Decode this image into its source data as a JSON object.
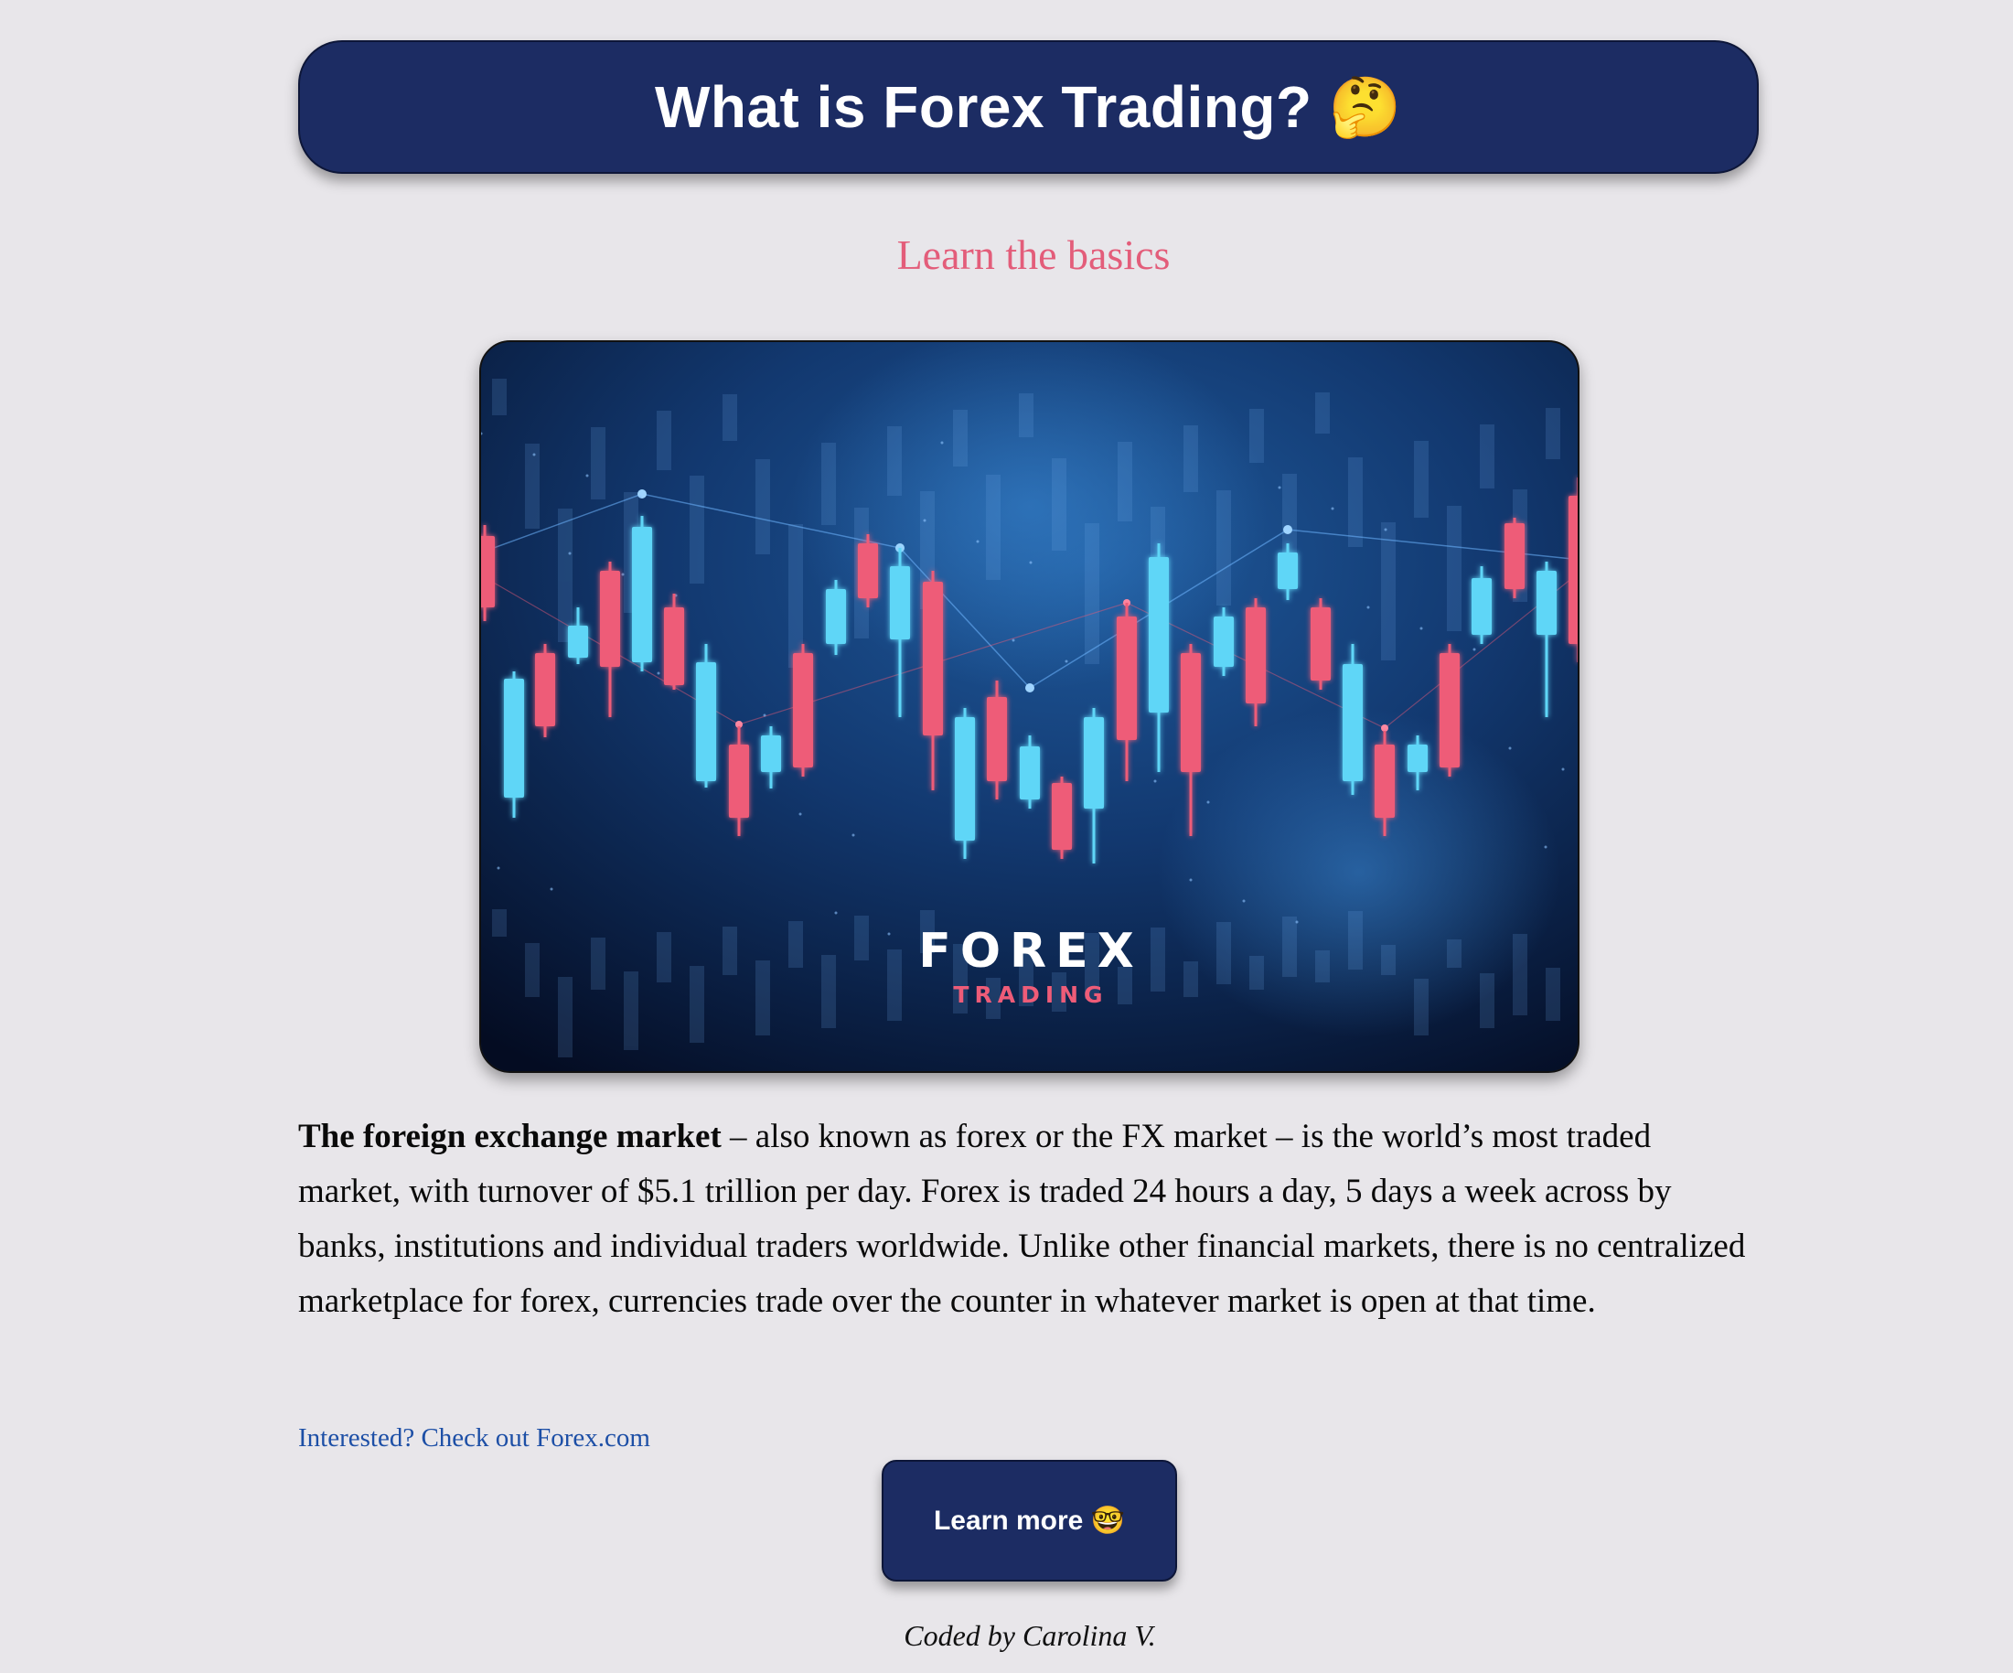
{
  "header": {
    "title": "What is Forex Trading? 🤔"
  },
  "subtitle": "Learn the basics",
  "hero": {
    "brand_main": "FOREX",
    "brand_sub": "TRADING",
    "colors": {
      "up": "#5fd6f7",
      "down": "#ee5c78",
      "background": "#0b2350"
    }
  },
  "body": {
    "lead_bold": "The foreign exchange market",
    "text": " – also known as forex or the FX market – is the world’s most traded market, with turnover of $5.1 trillion per day. Forex is traded 24 hours a day, 5 days a week across by banks, institutions and individual traders worldwide. Unlike other financial markets, there is no centralized marketplace for forex, currencies trade over the counter in whatever market is open at that time."
  },
  "link_text": "Interested? Check out Forex.com",
  "cta_label": "Learn more 🤓",
  "footer": "Coded by Carolina V.",
  "colors": {
    "page_bg": "#e8e6ea",
    "navy": "#1c2c63",
    "pink": "#e35d7a",
    "link": "#1d4fa6"
  }
}
